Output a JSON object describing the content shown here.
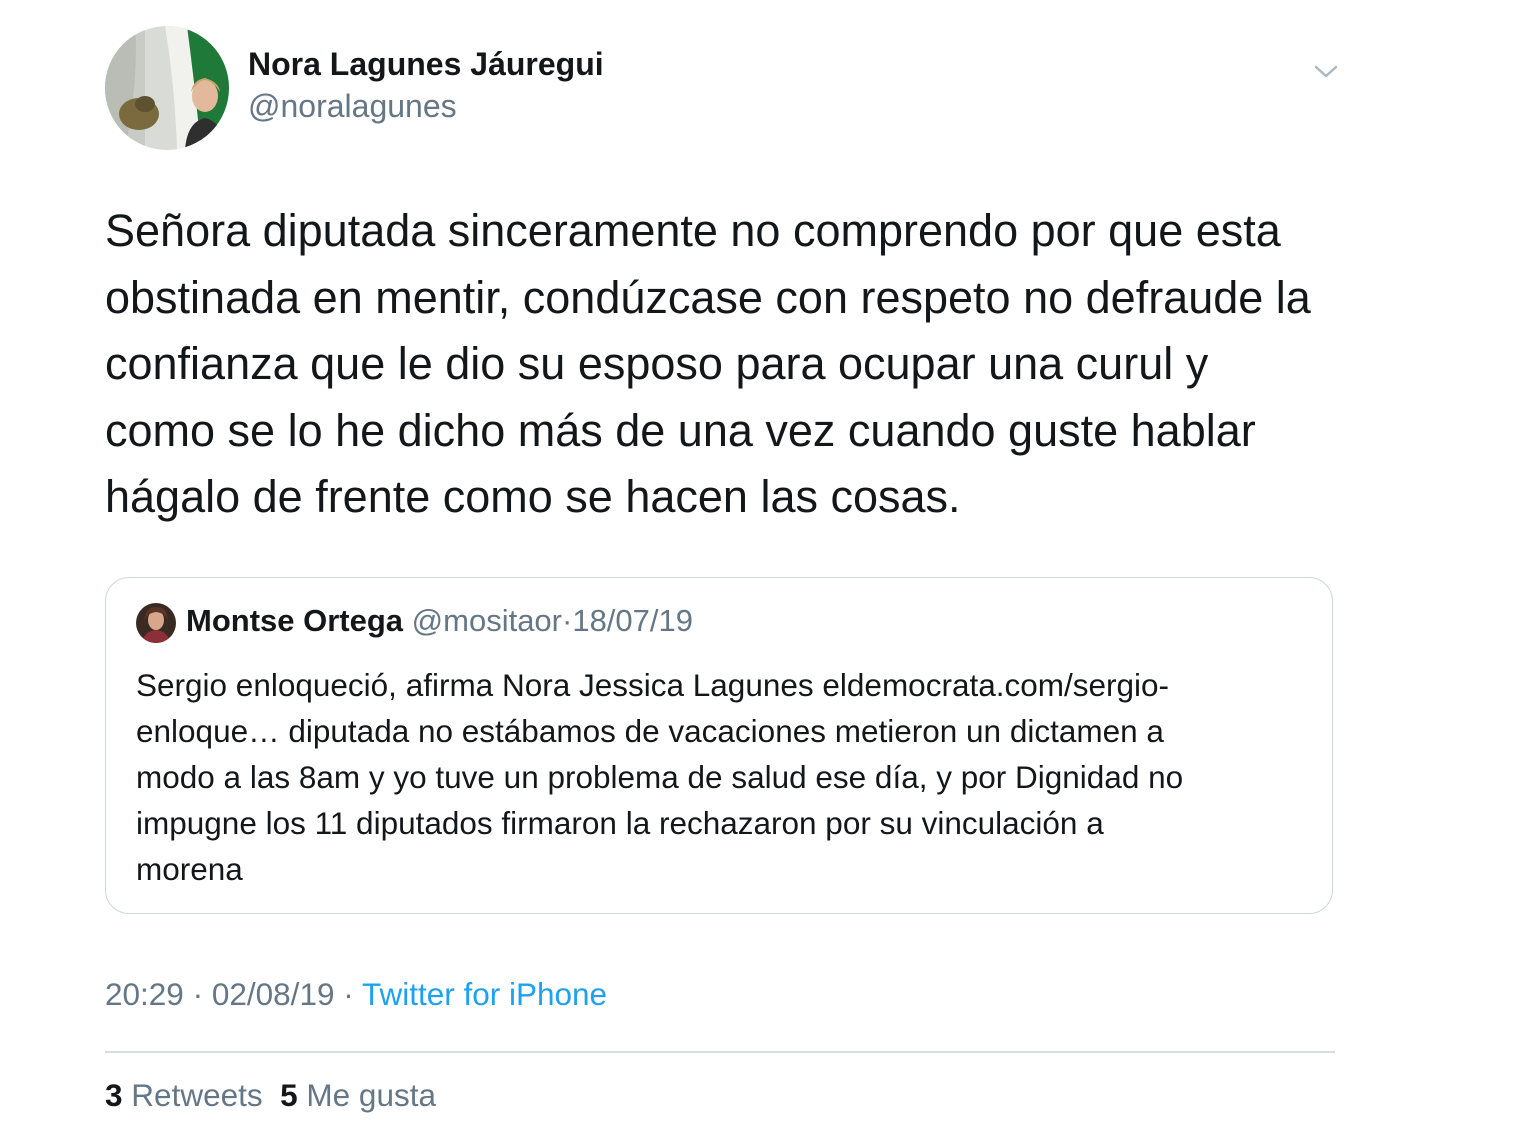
{
  "author": {
    "name": "Nora Lagunes Jáuregui",
    "handle": "@noralagunes",
    "avatar_icon": "profile-photo-flag-background"
  },
  "menu": {
    "icon": "chevron-down-icon"
  },
  "tweet": {
    "lines": [
      "Señora diputada sinceramente no comprendo por que esta",
      "obstinada en mentir, condúzcase con respeto no defraude la",
      "confianza que le dio su esposo para ocupar una curul y",
      "como se lo he dicho más de una vez cuando guste hablar",
      "hágalo de frente como se hacen las cosas."
    ]
  },
  "quoted": {
    "name": "Montse Ortega",
    "handle": "@mositaor",
    "separator": "·",
    "date": "18/07/19",
    "lines": [
      "Sergio enloqueció, afirma Nora Jessica Lagunes eldemocrata.com/sergio-",
      "enloque… diputada no estábamos de vacaciones metieron un dictamen a",
      "modo a las 8am y yo tuve un problema de salud ese día, y por Dignidad no",
      "impugne los 11 diputados firmaron la rechazaron por su vinculación a",
      "morena"
    ]
  },
  "meta": {
    "time": "20:29",
    "separator": "·",
    "date": "02/08/19",
    "source": "Twitter for iPhone"
  },
  "stats": {
    "retweets_count": "3",
    "retweets_label": "Retweets",
    "likes_count": "5",
    "likes_label": "Me gusta"
  },
  "colors": {
    "text": "#14171a",
    "secondary": "#657786",
    "link": "#1da1f2",
    "border": "#ccd6dd"
  }
}
